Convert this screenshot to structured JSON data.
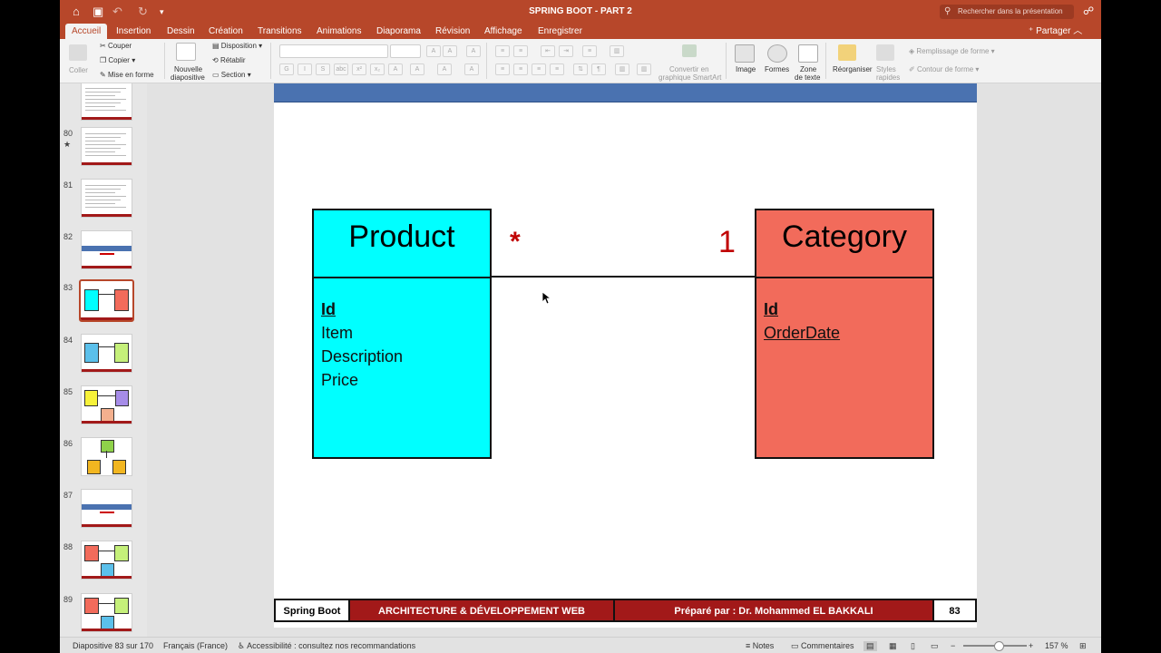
{
  "window": {
    "title": "SPRING BOOT - PART 2",
    "search_placeholder": "Rechercher dans la présentation"
  },
  "tabs": [
    "Accueil",
    "Insertion",
    "Dessin",
    "Création",
    "Transitions",
    "Animations",
    "Diaporama",
    "Révision",
    "Affichage",
    "Enregistrer"
  ],
  "share_label": "Partager",
  "ribbon": {
    "paste": "Coller",
    "cut": "Couper",
    "copy": "Copier",
    "format": "Mise en forme",
    "new_slide_1": "Nouvelle",
    "new_slide_2": "diapositive",
    "layout": "Disposition",
    "reset": "Rétablir",
    "section": "Section",
    "smartart_1": "Convertir en",
    "smartart_2": "graphique SmartArt",
    "image": "Image",
    "shapes": "Formes",
    "textbox_1": "Zone",
    "textbox_2": "de texte",
    "arrange": "Réorganiser",
    "quick_styles_1": "Styles",
    "quick_styles_2": "rapides",
    "shape_fill": "Remplissage de forme",
    "shape_outline": "Contour de forme"
  },
  "thumbnails": [
    {
      "num": "",
      "kind": "text"
    },
    {
      "num": "80",
      "kind": "text",
      "star": "★"
    },
    {
      "num": "81",
      "kind": "text"
    },
    {
      "num": "82",
      "kind": "title"
    },
    {
      "num": "83",
      "kind": "uml2",
      "selected": true
    },
    {
      "num": "84",
      "kind": "uml2b"
    },
    {
      "num": "85",
      "kind": "uml3"
    },
    {
      "num": "86",
      "kind": "uml_tree"
    },
    {
      "num": "87",
      "kind": "title"
    },
    {
      "num": "88",
      "kind": "uml3b"
    },
    {
      "num": "89",
      "kind": "uml3b"
    }
  ],
  "slide": {
    "left_entity": {
      "name": "Product",
      "key": "Id",
      "attributes": [
        "Item",
        "Description",
        "Price"
      ],
      "color": "#00ffff"
    },
    "right_entity": {
      "name": "Category",
      "key": "Id",
      "attributes": [
        "OrderDate"
      ],
      "color": "#f26b5b"
    },
    "left_multiplicity": "*",
    "right_multiplicity": "1",
    "footer": {
      "course": "Spring Boot",
      "subject": "ARCHITECTURE & DÉVELOPPEMENT WEB",
      "author": "Préparé par : Dr. Mohammed EL BAKKALI",
      "page": "83"
    }
  },
  "statusbar": {
    "slide_info": "Diapositive 83 sur 170",
    "language": "Français (France)",
    "accessibility": "Accessibilité : consultez nos recommandations",
    "notes": "Notes",
    "comments": "Commentaires",
    "zoom": "157 %"
  }
}
